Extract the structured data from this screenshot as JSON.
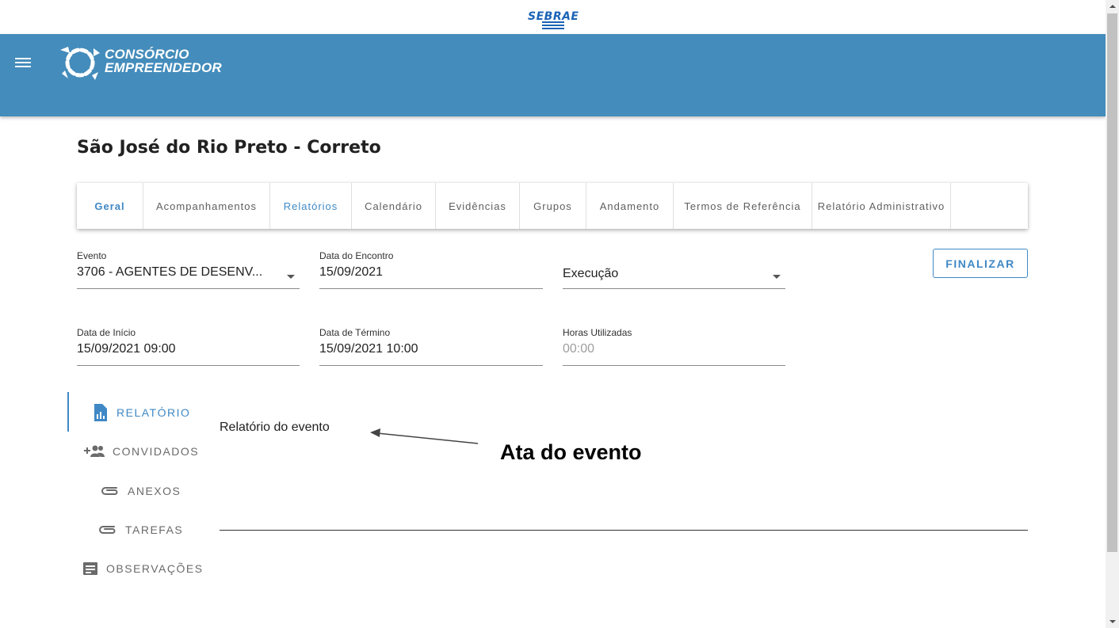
{
  "header": {
    "sebrae_logo": "SEBRAE",
    "brand_line1": "CONSÓRCIO",
    "brand_line2": "EMPREENDEDOR",
    "color": "#448cbb"
  },
  "page": {
    "title": "São José do Rio Preto - Correto"
  },
  "tabs": [
    {
      "label": "Geral",
      "state": "active"
    },
    {
      "label": "Acompanhamentos"
    },
    {
      "label": "Relatórios",
      "state": "selected"
    },
    {
      "label": "Calendário"
    },
    {
      "label": "Evidências"
    },
    {
      "label": "Grupos"
    },
    {
      "label": "Andamento"
    },
    {
      "label": "Termos de Referência"
    },
    {
      "label": "Relatório Administrativo"
    }
  ],
  "form": {
    "evento": {
      "label": "Evento",
      "value": "3706 - AGENTES DE DESENV..."
    },
    "data_encontro": {
      "label": "Data do Encontro",
      "value": "15/09/2021"
    },
    "status": {
      "value": "Execução"
    },
    "data_inicio": {
      "label": "Data de Início",
      "value": "15/09/2021 09:00"
    },
    "data_termino": {
      "label": "Data de Término",
      "value": "15/09/2021 10:00"
    },
    "horas": {
      "label": "Horas Utilizadas",
      "value": "00:00"
    },
    "finalizar_label": "FINALIZAR"
  },
  "sidenav": [
    {
      "label": "RELATÓRIO",
      "icon": "report-icon",
      "active": true
    },
    {
      "label": "CONVIDADOS",
      "icon": "add-group-icon"
    },
    {
      "label": "ANEXOS",
      "icon": "paperclip-icon"
    },
    {
      "label": "TAREFAS",
      "icon": "paperclip-icon"
    },
    {
      "label": "OBSERVAÇÕES",
      "icon": "notes-icon"
    }
  ],
  "report": {
    "label": "Relatório do evento",
    "value": ""
  },
  "annotation": {
    "text": "Ata do evento"
  },
  "accent_color": "#3f88c5"
}
